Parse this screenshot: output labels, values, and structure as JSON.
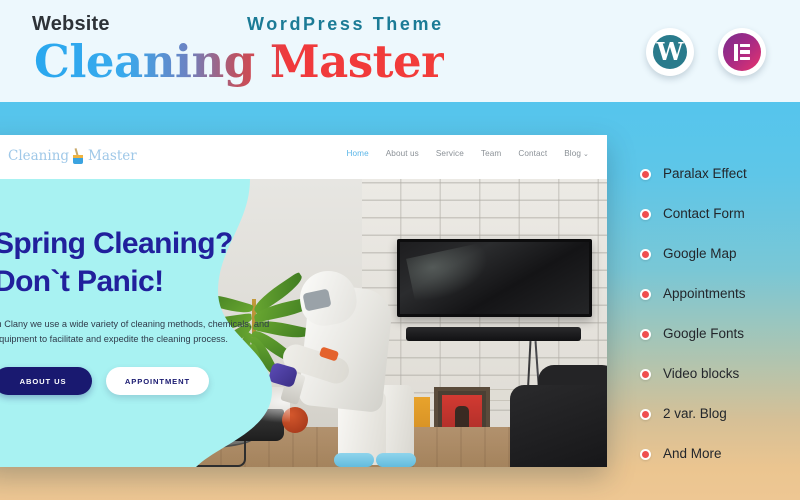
{
  "header": {
    "kicker_left": "Website",
    "kicker_right": "WordPress Theme",
    "title": "Cleaning Master",
    "badges": [
      {
        "name": "wordpress-logo",
        "glyph": "W"
      },
      {
        "name": "elementor-logo",
        "glyph": "E"
      }
    ]
  },
  "mockup": {
    "logo": {
      "text_before": "Cleaning",
      "text_after": "Master"
    },
    "menu": [
      {
        "label": "Home",
        "active": true
      },
      {
        "label": "About us",
        "active": false
      },
      {
        "label": "Service",
        "active": false
      },
      {
        "label": "Team",
        "active": false
      },
      {
        "label": "Contact",
        "active": false
      },
      {
        "label": "Blog",
        "active": false,
        "caret": "⌄"
      }
    ],
    "hero": {
      "heading_line1": "Spring Cleaning?",
      "heading_line2": "Don`t Panic!",
      "paragraph": "In Clany we use a wide variety of cleaning methods, chemicals, and equipment to facilitate and expedite the cleaning process.",
      "button_primary": "ABOUT US",
      "button_secondary": "APPOINTMENT"
    }
  },
  "features": [
    {
      "label": "Paralax Effect"
    },
    {
      "label": "Contact Form"
    },
    {
      "label": "Google Map"
    },
    {
      "label": "Appointments"
    },
    {
      "label": "Google Fonts"
    },
    {
      "label": "Video blocks"
    },
    {
      "label": "2 var. Blog"
    },
    {
      "label": "And More"
    }
  ],
  "colors": {
    "header_bg": "#edf8fd",
    "title_gradient_start": "#29a8ef",
    "title_gradient_end": "#f23c39",
    "kicker_right": "#1b7b96",
    "stage_top": "#55c5ed",
    "stage_bottom": "#eec793",
    "hero_overlay": "#a8f2f2",
    "hero_heading": "#21209c",
    "bullet": "#ef4f4f",
    "menu_active": "#5bb6e8"
  }
}
